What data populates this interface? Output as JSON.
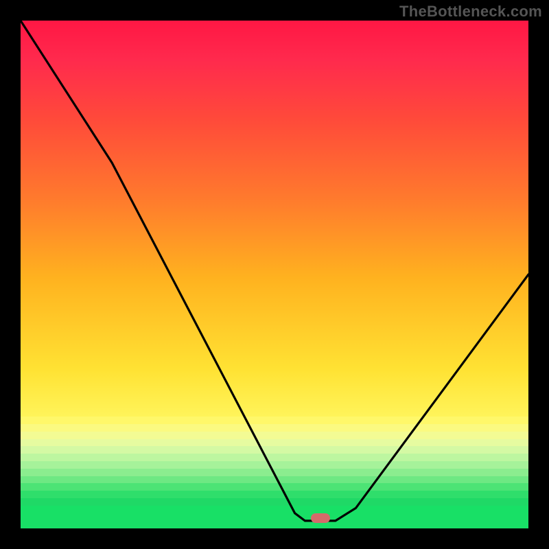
{
  "watermark": "TheBottleneck.com",
  "colors": {
    "frame": "#000000",
    "curve": "#000000",
    "marker": "#d46a6a",
    "green": "#18e066",
    "gradient_top": "#ff1744",
    "gradient_yellow": "#fff45a",
    "bands": [
      "#fff86a",
      "#fbfa81",
      "#f3fb94",
      "#e6fba0",
      "#d4f9a4",
      "#bdf6a0",
      "#a6f29a",
      "#8bed8f",
      "#6ee883",
      "#4de375",
      "#2fde6b",
      "#1fd966"
    ]
  },
  "chart_data": {
    "type": "line",
    "title": "",
    "xlabel": "",
    "ylabel": "",
    "x_range": [
      0,
      100
    ],
    "y_range": [
      0,
      100
    ],
    "note": "Background encodes bottleneck severity: red≈100 (bad) down to green≈0 (good). The black curve is a V-shape with its minimum near x≈59. The left branch descends from (0,100) with a slope break near (18,72); the right branch rises to roughly (100,50). A small pill marker sits at the valley floor.",
    "series": [
      {
        "name": "bottleneck-curve",
        "points": [
          {
            "x": 0,
            "y": 100
          },
          {
            "x": 18,
            "y": 72
          },
          {
            "x": 54,
            "y": 3
          },
          {
            "x": 56,
            "y": 1.5
          },
          {
            "x": 62,
            "y": 1.5
          },
          {
            "x": 66,
            "y": 4
          },
          {
            "x": 100,
            "y": 50
          }
        ]
      }
    ],
    "marker": {
      "x": 59,
      "y": 2
    }
  }
}
